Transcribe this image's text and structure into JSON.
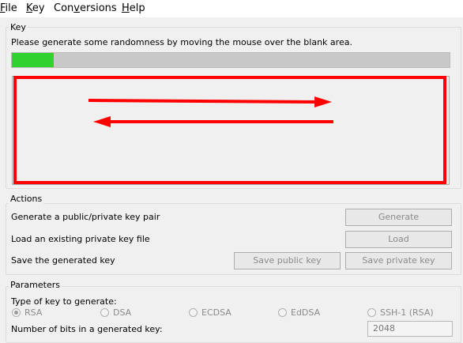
{
  "menu": {
    "file": {
      "label": "File",
      "mnemonic": "F"
    },
    "key": {
      "label": "Key",
      "mnemonic": "K"
    },
    "conversions": {
      "label": "Conversions",
      "mnemonic": "v"
    },
    "help": {
      "label": "Help",
      "mnemonic": "H"
    }
  },
  "key_group": {
    "title": "Key",
    "instruction": "Please generate some randomness by moving the mouse over the blank area.",
    "progress": 0.095,
    "progress_color": "#2fd22f"
  },
  "annotation": {
    "color": "#ff0000"
  },
  "actions": {
    "title": "Actions",
    "generate_label": "Generate a public/private key pair",
    "generate_button": "Generate",
    "load_label": "Load an existing private key file",
    "load_button": "Load",
    "save_label": "Save the generated key",
    "save_public_button": "Save public key",
    "save_private_button": "Save private key"
  },
  "parameters": {
    "title": "Parameters",
    "type_label": "Type of key to generate:",
    "key_types": [
      "RSA",
      "DSA",
      "ECDSA",
      "EdDSA",
      "SSH-1 (RSA)"
    ],
    "selected_type": "RSA",
    "bits_label": "Number of bits in a generated key:",
    "bits_value": "2048"
  }
}
